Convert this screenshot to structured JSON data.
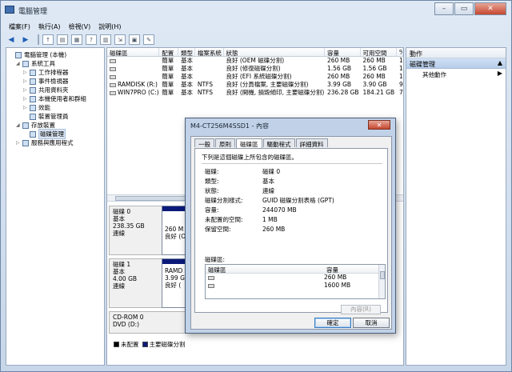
{
  "window": {
    "title": "電腦管理"
  },
  "menu": [
    "檔案(F)",
    "執行(A)",
    "檢視(V)",
    "說明(H)"
  ],
  "tree": [
    {
      "label": "電腦管理 (本機)",
      "indent": 0,
      "expander": ""
    },
    {
      "label": "系統工具",
      "indent": 1,
      "expander": "◢"
    },
    {
      "label": "工作排程器",
      "indent": 2,
      "expander": "▷"
    },
    {
      "label": "事件檢視器",
      "indent": 2,
      "expander": "▷"
    },
    {
      "label": "共用資料夾",
      "indent": 2,
      "expander": "▷"
    },
    {
      "label": "本機使用者和群組",
      "indent": 2,
      "expander": "▷"
    },
    {
      "label": "效能",
      "indent": 2,
      "expander": "▷"
    },
    {
      "label": "裝置管理員",
      "indent": 2,
      "expander": ""
    },
    {
      "label": "存放裝置",
      "indent": 1,
      "expander": "◢"
    },
    {
      "label": "磁碟管理",
      "indent": 2,
      "expander": "",
      "selected": true
    },
    {
      "label": "服務與應用程式",
      "indent": 1,
      "expander": "▷"
    }
  ],
  "volumes_table": {
    "headers": [
      "磁碟區",
      "配置",
      "類型",
      "檔案系統",
      "狀態",
      "容量",
      "可用空間",
      "%"
    ],
    "rows": [
      [
        "",
        "簡單",
        "基本",
        "",
        "良好 (OEM 磁碟分割)",
        "260 MB",
        "260 MB",
        "10"
      ],
      [
        "",
        "簡單",
        "基本",
        "",
        "良好 (修復磁碟分割)",
        "1.56 GB",
        "1.56 GB",
        "10"
      ],
      [
        "",
        "簡單",
        "基本",
        "",
        "良好 (EFI 系統磁碟分割)",
        "260 MB",
        "260 MB",
        "10"
      ],
      [
        "RAMDISK (R:)",
        "簡單",
        "基本",
        "NTFS",
        "良好 (分頁檔案, 主要磁碟分割)",
        "3.99 GB",
        "3.90 GB",
        "98"
      ],
      [
        "WIN7PRO (C:)",
        "簡單",
        "基本",
        "NTFS",
        "良好 (開機, 損毀傾印, 主要磁碟分割)",
        "236.28 GB",
        "184.21 GB",
        "78"
      ]
    ]
  },
  "disks": [
    {
      "name": "磁碟 0",
      "type": "基本",
      "size": "238.35 GB",
      "status": "連線",
      "part_size": "260 M",
      "part_status": "良好 (O"
    },
    {
      "name": "磁碟 1",
      "type": "基本",
      "size": "4.00 GB",
      "status": "連線",
      "part_name": "RAMD",
      "part_size": "3.99 G",
      "part_status": "良好 ("
    },
    {
      "name": "CD-ROM 0",
      "type": "DVD (D:)"
    }
  ],
  "legend": [
    {
      "label": "未配置",
      "color": "#000000"
    },
    {
      "label": "主要磁碟分割",
      "color": "#0b1a7a"
    }
  ],
  "actions": {
    "header": "動作",
    "section": "磁碟管理",
    "item": "其他動作"
  },
  "dialog": {
    "title": "M4-CT256M4SSD1 - 內容",
    "close_label": "✕",
    "tabs": [
      "一般",
      "原則",
      "磁碟區",
      "驅動程式",
      "詳細資料"
    ],
    "active_tab": 2,
    "description": "下列是這個磁碟上所包含的磁碟區。",
    "fields": [
      {
        "key": "磁碟:",
        "value": "磁碟 0"
      },
      {
        "key": "類型:",
        "value": "基本"
      },
      {
        "key": "狀態:",
        "value": "連線"
      },
      {
        "key": "磁碟分割樣式:",
        "value": "GUID 磁碟分割表格 (GPT)"
      },
      {
        "key": "容量:",
        "value": "244070 MB"
      },
      {
        "key": "未配置的空間:",
        "value": "1 MB"
      },
      {
        "key": "保留空間:",
        "value": "260 MB"
      }
    ],
    "volumes_label": "磁碟區:",
    "volumes_headers": [
      "磁碟區",
      "容量"
    ],
    "volumes_rows": [
      {
        "capacity": "260 MB"
      },
      {
        "capacity": "1600 MB"
      }
    ],
    "properties_button": "內容(R)",
    "ok_button": "確定",
    "cancel_button": "取消"
  }
}
